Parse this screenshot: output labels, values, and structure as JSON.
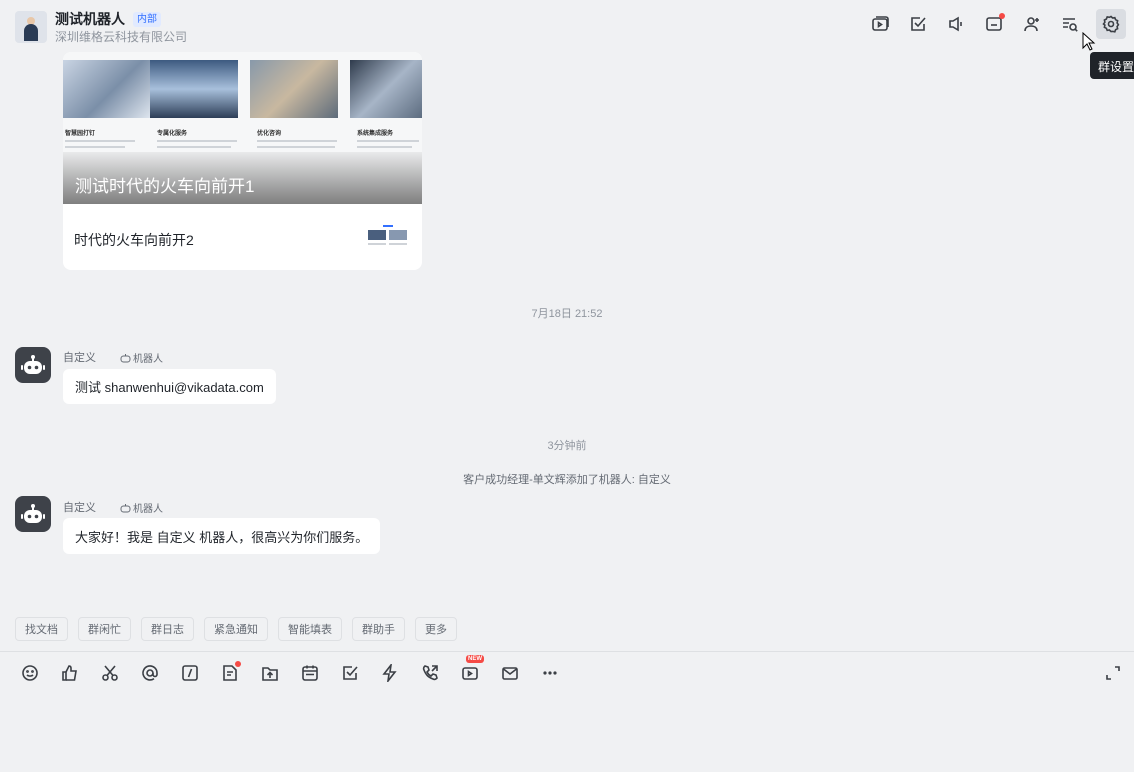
{
  "header": {
    "title": "测试机器人",
    "badge": "内部",
    "subtitle": "深圳维格云科技有限公司",
    "tooltip": "群设置"
  },
  "icons": {
    "header": [
      "meeting-icon",
      "task-icon",
      "announcement-icon",
      "chat-box-icon",
      "add-member-icon",
      "search-history-icon",
      "settings-icon"
    ],
    "toolbar": [
      "emoji-icon",
      "thumbs-up-icon",
      "scissors-icon",
      "mention-icon",
      "slash-command-icon",
      "doc-icon",
      "upload-icon",
      "calendar-icon",
      "todo-icon",
      "lightning-icon",
      "call-icon",
      "live-icon",
      "mail-icon",
      "more-icon"
    ]
  },
  "card": {
    "title": "测试时代的火车向前开1",
    "subtitle": "时代的火车向前开2",
    "columns": [
      "智慧园打钉",
      "专属化服务",
      "优化咨询",
      "系统集成服务"
    ]
  },
  "messages": [
    {
      "time": "7月18日 21:52",
      "sender": "自定义",
      "tag": "机器人",
      "text": "测试 shanwenhui@vikadata.com"
    },
    {
      "time": "3分钟前",
      "system": "客户成功经理-单文辉添加了机器人: 自定义",
      "sender": "自定义",
      "tag": "机器人",
      "text": "大家好！我是 自定义 机器人，很高兴为你们服务。"
    }
  ],
  "quick_actions": [
    "找文档",
    "群闲忙",
    "群日志",
    "紧急通知",
    "智能填表",
    "群助手",
    "更多"
  ],
  "toolbar": {
    "new_badge": "NEW"
  },
  "colors": {
    "background": "#f0f1f3",
    "accent": "#3370ff",
    "alert": "#f54a45"
  }
}
